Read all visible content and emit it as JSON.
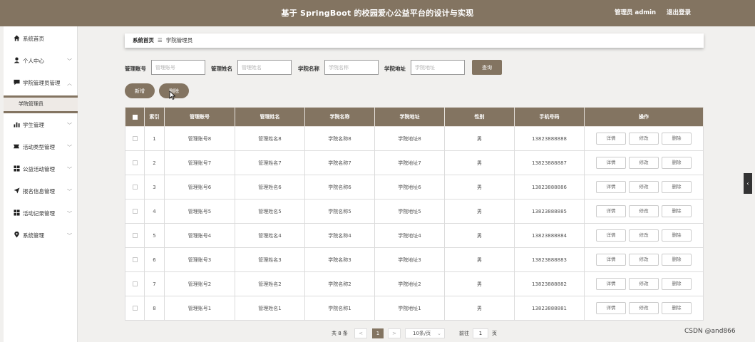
{
  "header": {
    "title": "基于 SpringBoot 的校园爱心公益平台的设计与实现",
    "admin_label": "管理员 admin",
    "logout_label": "退出登录"
  },
  "sidebar": {
    "items": [
      {
        "label": "系统首页",
        "icon": "home-icon"
      },
      {
        "label": "个人中心",
        "icon": "user-icon"
      },
      {
        "label": "学院管理员管理",
        "icon": "chat-icon"
      },
      {
        "label": "学生管理",
        "icon": "bar-chart-icon"
      },
      {
        "label": "活动类型管理",
        "icon": "tag-icon"
      },
      {
        "label": "公益活动管理",
        "icon": "grid-icon"
      },
      {
        "label": "报名信息管理",
        "icon": "send-icon"
      },
      {
        "label": "活动记录管理",
        "icon": "grid-icon"
      },
      {
        "label": "系统管理",
        "icon": "pin-icon"
      }
    ],
    "active_sub": "学院管理员"
  },
  "breadcrumb": {
    "home": "系统首页",
    "current": "学院管理员"
  },
  "search": {
    "fields": [
      {
        "label": "管理账号",
        "placeholder": "管理账号"
      },
      {
        "label": "管理姓名",
        "placeholder": "管理姓名"
      },
      {
        "label": "学院名称",
        "placeholder": "学院名称"
      },
      {
        "label": "学院地址",
        "placeholder": "学院地址"
      }
    ],
    "query_label": "查询"
  },
  "actions": {
    "add_label": "新增",
    "delete_label": "删除"
  },
  "table": {
    "columns": [
      "索引",
      "管理账号",
      "管理姓名",
      "学院名称",
      "学院地址",
      "性别",
      "手机号码",
      "操作"
    ],
    "rows": [
      {
        "index": "1",
        "account": "管理账号8",
        "name": "管理姓名8",
        "college": "学院名称8",
        "address": "学院地址8",
        "gender": "男",
        "phone": "13823888888"
      },
      {
        "index": "2",
        "account": "管理账号7",
        "name": "管理姓名7",
        "college": "学院名称7",
        "address": "学院地址7",
        "gender": "男",
        "phone": "13823888887"
      },
      {
        "index": "3",
        "account": "管理账号6",
        "name": "管理姓名6",
        "college": "学院名称6",
        "address": "学院地址6",
        "gender": "男",
        "phone": "13823888886"
      },
      {
        "index": "4",
        "account": "管理账号5",
        "name": "管理姓名5",
        "college": "学院名称5",
        "address": "学院地址5",
        "gender": "男",
        "phone": "13823888885"
      },
      {
        "index": "5",
        "account": "管理账号4",
        "name": "管理姓名4",
        "college": "学院名称4",
        "address": "学院地址4",
        "gender": "男",
        "phone": "13823888884"
      },
      {
        "index": "6",
        "account": "管理账号3",
        "name": "管理姓名3",
        "college": "学院名称3",
        "address": "学院地址3",
        "gender": "男",
        "phone": "13823888883"
      },
      {
        "index": "7",
        "account": "管理账号2",
        "name": "管理姓名2",
        "college": "学院名称2",
        "address": "学院地址2",
        "gender": "男",
        "phone": "13823888882"
      },
      {
        "index": "8",
        "account": "管理账号1",
        "name": "管理姓名1",
        "college": "学院名称1",
        "address": "学院地址1",
        "gender": "男",
        "phone": "13823888881"
      }
    ],
    "row_actions": {
      "detail": "详情",
      "edit": "修改",
      "delete": "删除"
    }
  },
  "pagination": {
    "total_text": "共 8 条",
    "prev": "<",
    "current_page": "1",
    "next": ">",
    "page_size": "10条/页",
    "goto_label": "前往",
    "goto_value": "1",
    "page_unit": "页"
  },
  "right_tab": "‹",
  "watermark": "CSDN @and866",
  "colors": {
    "primary": "#837461"
  }
}
